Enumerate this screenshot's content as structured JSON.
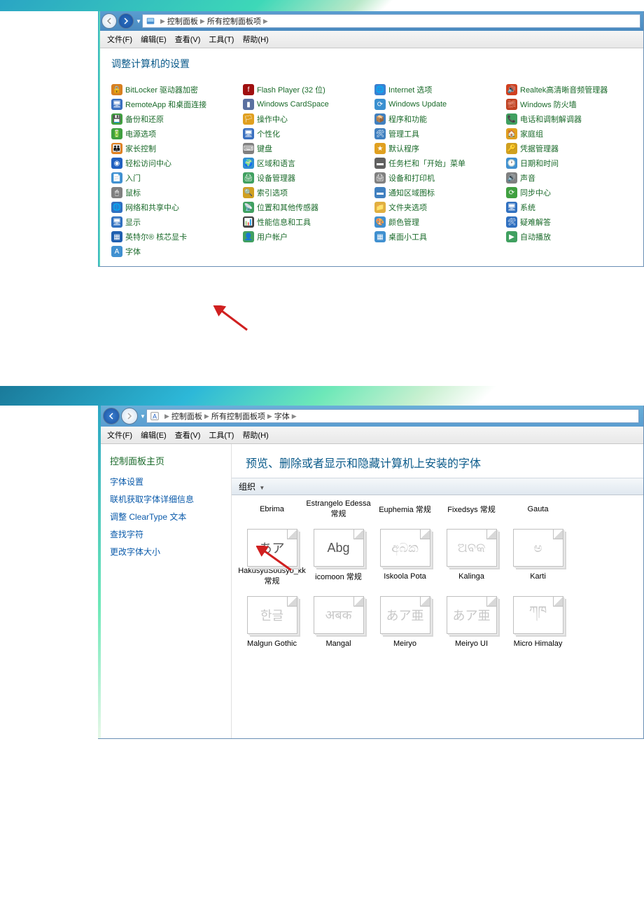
{
  "window1": {
    "breadcrumb": {
      "part1": "控制面板",
      "part2": "所有控制面板项"
    },
    "menubar": [
      "文件(F)",
      "编辑(E)",
      "查看(V)",
      "工具(T)",
      "帮助(H)"
    ],
    "heading": "调整计算机的设置",
    "items": [
      {
        "name": "bitlocker",
        "label": "BitLocker 驱动器加密",
        "icon": "🔒",
        "bg": "#d88020"
      },
      {
        "name": "flash-player",
        "label": "Flash Player (32 位)",
        "icon": "f",
        "bg": "#a01010"
      },
      {
        "name": "internet-options",
        "label": "Internet 选项",
        "icon": "🌐",
        "bg": "#3a80d0"
      },
      {
        "name": "realtek-audio",
        "label": "Realtek高清晰音频管理器",
        "icon": "🔊",
        "bg": "#d04020"
      },
      {
        "name": "remoteapp",
        "label": "RemoteApp 和桌面连接",
        "icon": "🖥",
        "bg": "#3a70c0"
      },
      {
        "name": "windows-cardspace",
        "label": "Windows CardSpace",
        "icon": "▮",
        "bg": "#5a70a0"
      },
      {
        "name": "windows-update",
        "label": "Windows Update",
        "icon": "⟳",
        "bg": "#3a90d0"
      },
      {
        "name": "windows-firewall",
        "label": "Windows 防火墙",
        "icon": "🧱",
        "bg": "#c04020"
      },
      {
        "name": "backup-restore",
        "label": "备份和还原",
        "icon": "💾",
        "bg": "#40a040"
      },
      {
        "name": "action-center",
        "label": "操作中心",
        "icon": "🏳",
        "bg": "#e0a020"
      },
      {
        "name": "programs-features",
        "label": "程序和功能",
        "icon": "📦",
        "bg": "#4080c0"
      },
      {
        "name": "phone-modem",
        "label": "电话和调制解调器",
        "icon": "📞",
        "bg": "#40a060"
      },
      {
        "name": "power-options",
        "label": "电源选项",
        "icon": "🔋",
        "bg": "#40a040"
      },
      {
        "name": "personalization",
        "label": "个性化",
        "icon": "🖥",
        "bg": "#3a70c0"
      },
      {
        "name": "admin-tools",
        "label": "管理工具",
        "icon": "🛠",
        "bg": "#4080c0"
      },
      {
        "name": "homegroup",
        "label": "家庭组",
        "icon": "🏠",
        "bg": "#e0a020"
      },
      {
        "name": "parental-controls",
        "label": "家长控制",
        "icon": "👪",
        "bg": "#e08020"
      },
      {
        "name": "keyboard",
        "label": "键盘",
        "icon": "⌨",
        "bg": "#808080"
      },
      {
        "name": "default-programs",
        "label": "默认程序",
        "icon": "★",
        "bg": "#e0a020"
      },
      {
        "name": "credential-manager",
        "label": "凭据管理器",
        "icon": "🔑",
        "bg": "#d0a020"
      },
      {
        "name": "ease-of-access",
        "label": "轻松访问中心",
        "icon": "◉",
        "bg": "#2060c0"
      },
      {
        "name": "region-language",
        "label": "区域和语言",
        "icon": "🌍",
        "bg": "#3090d0"
      },
      {
        "name": "taskbar-start",
        "label": "任务栏和「开始」菜单",
        "icon": "▬",
        "bg": "#606060"
      },
      {
        "name": "date-time",
        "label": "日期和时间",
        "icon": "🕐",
        "bg": "#4090d0"
      },
      {
        "name": "getting-started",
        "label": "入门",
        "icon": "📄",
        "bg": "#4090d0"
      },
      {
        "name": "device-manager",
        "label": "设备管理器",
        "icon": "🖨",
        "bg": "#40a060"
      },
      {
        "name": "devices-printers",
        "label": "设备和打印机",
        "icon": "🖨",
        "bg": "#808080"
      },
      {
        "name": "sound",
        "label": "声音",
        "icon": "🔊",
        "bg": "#808080"
      },
      {
        "name": "mouse",
        "label": "鼠标",
        "icon": "🖱",
        "bg": "#808080"
      },
      {
        "name": "indexing-options",
        "label": "索引选项",
        "icon": "🔍",
        "bg": "#d0a020"
      },
      {
        "name": "notification-icons",
        "label": "通知区域图标",
        "icon": "▬",
        "bg": "#4080c0"
      },
      {
        "name": "sync-center",
        "label": "同步中心",
        "icon": "⟳",
        "bg": "#40a040"
      },
      {
        "name": "network-sharing",
        "label": "网络和共享中心",
        "icon": "🌐",
        "bg": "#3070c0"
      },
      {
        "name": "location-sensors",
        "label": "位置和其他传感器",
        "icon": "📡",
        "bg": "#40a060"
      },
      {
        "name": "folder-options",
        "label": "文件夹选项",
        "icon": "📁",
        "bg": "#e0b040"
      },
      {
        "name": "system",
        "label": "系统",
        "icon": "🖥",
        "bg": "#3070c0"
      },
      {
        "name": "display",
        "label": "显示",
        "icon": "🖥",
        "bg": "#3070c0"
      },
      {
        "name": "performance-tools",
        "label": "性能信息和工具",
        "icon": "📊",
        "bg": "#404040"
      },
      {
        "name": "color-management",
        "label": "颜色管理",
        "icon": "🎨",
        "bg": "#4090d0"
      },
      {
        "name": "troubleshooting",
        "label": "疑难解答",
        "icon": "🛠",
        "bg": "#3070c0"
      },
      {
        "name": "intel-graphics",
        "label": "英特尔® 核芯显卡",
        "icon": "▦",
        "bg": "#2060b0"
      },
      {
        "name": "user-accounts",
        "label": "用户帐户",
        "icon": "👤",
        "bg": "#40a060"
      },
      {
        "name": "desktop-gadgets",
        "label": "桌面小工具",
        "icon": "▦",
        "bg": "#4090d0"
      },
      {
        "name": "autoplay",
        "label": "自动播放",
        "icon": "▶",
        "bg": "#40a060"
      },
      {
        "name": "fonts",
        "label": "字体",
        "icon": "A",
        "bg": "#4090d0"
      }
    ]
  },
  "window2": {
    "breadcrumb": {
      "part1": "控制面板",
      "part2": "所有控制面板项",
      "part3": "字体"
    },
    "menubar": [
      "文件(F)",
      "编辑(E)",
      "查看(V)",
      "工具(T)",
      "帮助(H)"
    ],
    "sidebar": {
      "home": "控制面板主页",
      "links": [
        {
          "name": "font-settings",
          "label": "字体设置"
        },
        {
          "name": "online-font-info",
          "label": "联机获取字体详细信息"
        },
        {
          "name": "adjust-cleartype",
          "label": "调整 ClearType 文本"
        },
        {
          "name": "find-char",
          "label": "查找字符"
        },
        {
          "name": "change-font-size",
          "label": "更改字体大小"
        }
      ]
    },
    "heading": "预览、删除或者显示和隐藏计算机上安装的字体",
    "organize": "组织",
    "fonts_row1": [
      {
        "name": "Ebrima",
        "preview": "",
        "faded": false
      },
      {
        "name": "Estrangelo Edessa 常规",
        "preview": "",
        "faded": false
      },
      {
        "name": "Euphemia 常规",
        "preview": "",
        "faded": false
      },
      {
        "name": "Fixedsys 常规",
        "preview": "",
        "faded": false
      },
      {
        "name": "Gauta",
        "preview": "",
        "faded": false
      }
    ],
    "fonts_row2": [
      {
        "name": "HakusyuSousyo_kk 常规",
        "preview": "あア",
        "faded": false
      },
      {
        "name": "icomoon 常规",
        "preview": "Abg",
        "faded": false
      },
      {
        "name": "Iskoola Pota",
        "preview": "අබක",
        "faded": true
      },
      {
        "name": "Kalinga",
        "preview": "ଅବକ",
        "faded": true
      },
      {
        "name": "Karti",
        "preview": "ಅ",
        "faded": true
      }
    ],
    "fonts_row3": [
      {
        "name": "Malgun Gothic",
        "preview": "한글",
        "faded": true
      },
      {
        "name": "Mangal",
        "preview": "अबक",
        "faded": true
      },
      {
        "name": "Meiryo",
        "preview": "あア亜",
        "faded": true
      },
      {
        "name": "Meiryo UI",
        "preview": "あア亜",
        "faded": true
      },
      {
        "name": "Micro Himalay",
        "preview": "ཀཁ",
        "faded": true
      }
    ]
  }
}
